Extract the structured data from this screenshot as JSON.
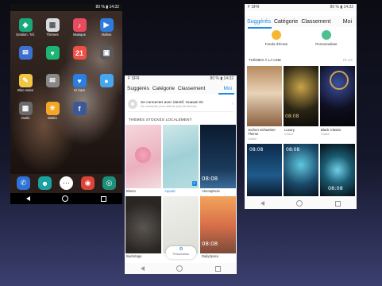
{
  "phone1": {
    "status": {
      "left": "",
      "right": "80 % ▮ 14:32"
    },
    "apps": [
      {
        "label": "Gestion. Tél.",
        "color": "#1aa87a",
        "glyph": "◈",
        "icon": "shield-icon"
      },
      {
        "label": "Thèmes",
        "color": "#d8dbe0",
        "glyph": "▦",
        "icon": "brush-icon"
      },
      {
        "label": "Musique",
        "color": "#e84a5f",
        "glyph": "♪",
        "icon": "music-icon"
      },
      {
        "label": "Vidéos",
        "color": "#2e7bdc",
        "glyph": "▶",
        "icon": "play-icon"
      },
      {
        "label": "",
        "color": "#3c6fd1",
        "glyph": "✉",
        "icon": "email-icon"
      },
      {
        "label": "",
        "color": "#1cb574",
        "glyph": "♥",
        "icon": "health-icon"
      },
      {
        "label": "",
        "color": "#f24f44",
        "glyph": "21",
        "icon": "calendar-icon"
      },
      {
        "label": "",
        "color": "#5a5a5a",
        "glyph": "▣",
        "icon": "grid-icon"
      },
      {
        "label": "Bloc-notes",
        "color": "#f3c544",
        "glyph": "✎",
        "icon": "notepad-icon"
      },
      {
        "label": "",
        "color": "#888888",
        "glyph": "✉",
        "icon": "message-icon"
      },
      {
        "label": "Hi Care",
        "color": "#2a7ee0",
        "glyph": "♥",
        "icon": "support-icon"
      },
      {
        "label": "",
        "color": "#46a6f0",
        "glyph": "●",
        "icon": "chat-icon"
      },
      {
        "label": "Outils",
        "color": "#6a6a6a",
        "glyph": "▦",
        "icon": "tools-icon"
      },
      {
        "label": "Météo",
        "color": "#f5a623",
        "glyph": "☀",
        "icon": "weather-icon"
      },
      {
        "label": "",
        "color": "#3b5998",
        "glyph": "f",
        "icon": "facebook-icon"
      }
    ],
    "dock": [
      {
        "color": "#2f73d8",
        "glyph": "✆",
        "icon": "phone-icon"
      },
      {
        "color": "#1aa2a0",
        "glyph": "☻",
        "icon": "contacts-icon"
      },
      {
        "color": "#ffffff",
        "glyph": "⋯",
        "icon": "app-drawer-icon"
      },
      {
        "color": "#db4437",
        "glyph": "◉",
        "icon": "chrome-icon"
      },
      {
        "color": "#1b8f7a",
        "glyph": "◎",
        "icon": "camera-icon"
      }
    ]
  },
  "phone2": {
    "status": {
      "left": "F SFR",
      "right": "80 % ▮ 14:32"
    },
    "tabs": [
      "Suggérés",
      "Catégorie",
      "Classement",
      "Moi"
    ],
    "signin_title": "Se connecter avec identif. Huawei ID",
    "signin_sub": "Se connecter pour obtenir plus de thèmes",
    "section": "THÈMES STOCKÉS LOCALEMENT",
    "themes": [
      {
        "name": "Bloom",
        "selected": false,
        "clock": ""
      },
      {
        "name": "Aquatic",
        "selected": true,
        "clock": ""
      },
      {
        "name": "Atmospheric",
        "selected": false,
        "clock": "08:08"
      },
      {
        "name": "Backstage",
        "selected": false,
        "clock": ""
      },
      {
        "name": "",
        "selected": false,
        "clock": ""
      },
      {
        "name": "DailySpace",
        "selected": false,
        "clock": "08:08"
      }
    ],
    "fab_label": "Personnaliser"
  },
  "phone3": {
    "status": {
      "left": "F SFR",
      "right": "80 % ▮ 14:32"
    },
    "tabs": [
      "Suggérés",
      "Catégorie",
      "Classement",
      "Moi"
    ],
    "cat1": "Fonds d'écran",
    "cat2": "Personnaliser",
    "section": "THÈMES À LA UNE",
    "plus": "PLUS",
    "featured": [
      {
        "name": "Jochen Schweizer Theme",
        "price": "Gratuit"
      },
      {
        "name": "Luxury",
        "price": "Gratuit"
      },
      {
        "name": "Black Classic",
        "price": "Gratuit"
      }
    ],
    "row2_clocks": [
      "08:08",
      "08:08",
      "08:08"
    ]
  }
}
